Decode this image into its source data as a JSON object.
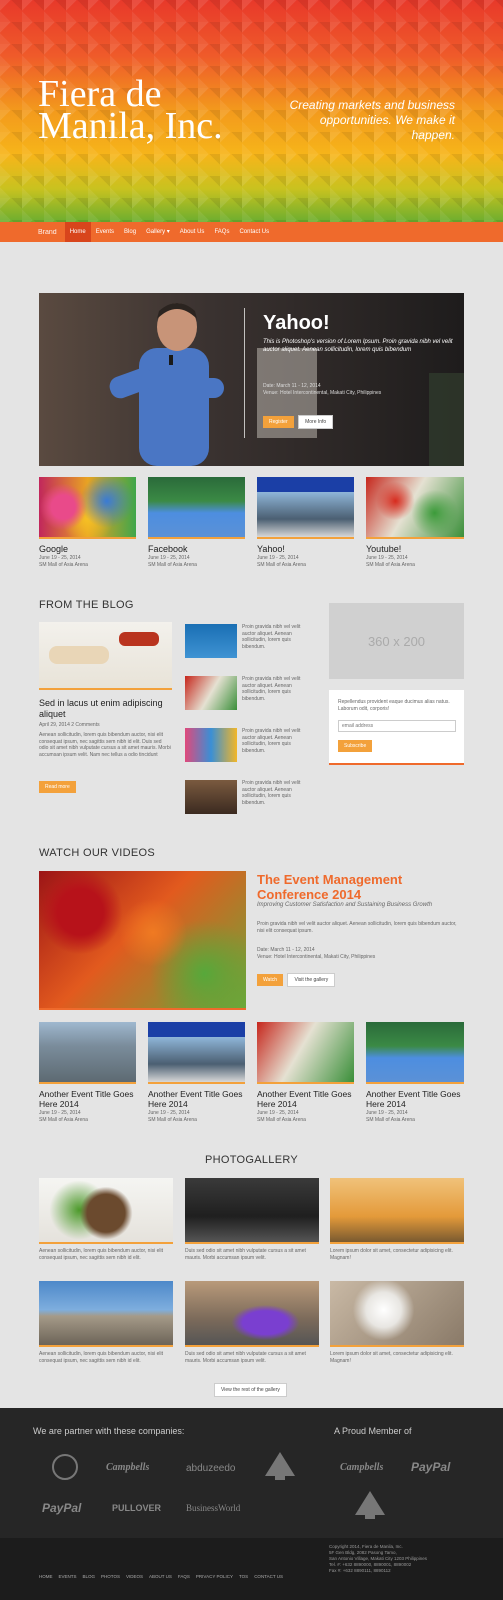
{
  "hero": {
    "title": "Fiera de Manila, Inc.",
    "tagline": "Creating markets and business opportunities. We make it happen."
  },
  "nav": {
    "brand": "Brand",
    "items": [
      "Home",
      "Events",
      "Blog",
      "Gallery ▾",
      "About Us",
      "FAQs",
      "Contact Us"
    ],
    "active_index": 0
  },
  "featured": {
    "title": "Yahoo!",
    "desc": "This is Photoshop's version of Lorem Ipsum. Proin gravida nibh vel velit auctor aliquet. Aenean sollicitudin, lorem quis bibendum",
    "date": "Date: March 11 - 12, 2014",
    "venue": "Venue: Hotel Intercontinental, Makati City, Philippines",
    "btn1": "Register",
    "btn2": "More Info"
  },
  "event_cards": [
    {
      "title": "Google",
      "date": "June 19 - 25, 2014",
      "venue": "SM Mall of Asia Arena"
    },
    {
      "title": "Facebook",
      "date": "June 19 - 25, 2014",
      "venue": "SM Mall of Asia Arena"
    },
    {
      "title": "Yahoo!",
      "date": "June 19 - 25, 2014",
      "venue": "SM Mall of Asia Arena"
    },
    {
      "title": "Youtube!",
      "date": "June 19 - 25, 2014",
      "venue": "SM Mall of Asia Arena"
    }
  ],
  "blog": {
    "heading": "FROM THE BLOG",
    "main_title": "Sed in lacus ut enim adipiscing aliquet",
    "main_meta": "April 29, 2014 2 Comments",
    "main_text": "Aenean sollicitudin, lorem quis bibendum auctor, nisi elit consequat ipsum, nec sagittis sem nibh id elit. Duis sed odio sit amet nibh vulputate cursus a sit amet mauris. Morbi accumsan ipsum velit. Nam nec tellus a odio tincidunt",
    "read_more": "Read more",
    "side_posts": [
      "Proin gravida nibh vel velit auctor aliquet. Aenean sollicitudin, lorem quis bibendum.",
      "Proin gravida nibh vel velit auctor aliquet. Aenean sollicitudin, lorem quis bibendum.",
      "Proin gravida nibh vel velit auctor aliquet. Aenean sollicitudin, lorem quis bibendum.",
      "Proin gravida nibh vel velit auctor aliquet. Aenean sollicitudin, lorem quis bibendum."
    ],
    "ad_placeholder": "360 x 200",
    "newsletter_text": "Repellendus provident eaque ducimus alias natus. Laborum odit, corporis!",
    "email_placeholder": "email address",
    "subscribe": "Subscribe"
  },
  "videos": {
    "heading": "WATCH OUR VIDEOS",
    "title": "The Event Management Conference 2014",
    "subtitle": "Improving Customer Satisfaction and Sustaining Business Growth",
    "desc": "Proin gravida nibh vel velit auctor aliquet. Aenean sollicitudin, lorem quis bibendum auctor, nisi elit consequat ipsum.",
    "date": "Date: March 11 - 12, 2014",
    "venue": "Venue: Hotel Intercontinental, Makati City, Philippines",
    "btn1": "Watch",
    "btn2": "Visit the gallery",
    "cards": [
      {
        "title": "Another Event Title Goes Here 2014",
        "date": "June 19 - 25, 2014",
        "venue": "SM Mall of Asia Arena"
      },
      {
        "title": "Another Event Title Goes Here 2014",
        "date": "June 19 - 25, 2014",
        "venue": "SM Mall of Asia Arena"
      },
      {
        "title": "Another Event Title Goes Here 2014",
        "date": "June 19 - 25, 2014",
        "venue": "SM Mall of Asia Arena"
      },
      {
        "title": "Another Event Title Goes Here 2014",
        "date": "June 19 - 25, 2014",
        "venue": "SM Mall of Asia Arena"
      }
    ]
  },
  "gallery": {
    "heading": "PHOTOGALLERY",
    "captions": [
      "Aenean sollicitudin, lorem quis bibendum auctor, nisi elit consequat ipsum, nec sagittis sem nibh id elit.",
      "Duis sed odio sit amet nibh vulputate cursus a sit amet mauris. Morbi accumsan ipsum velit.",
      "Lorem ipsum dolor sit amet, consectetur adipisicing elit. Magnam!",
      "Aenean sollicitudin, lorem quis bibendum auctor, nisi elit consequat ipsum, nec sagittis sem nibh id elit.",
      "Duis sed odio sit amet nibh vulputate cursus a sit amet mauris. Morbi accumsan ipsum velit.",
      "Lorem ipsum dolor sit amet, consectetur adipisicing elit. Magnam!"
    ],
    "view_rest": "View the rest of the gallery"
  },
  "partners": {
    "heading": "We are partner with these companies:",
    "member_heading": "A Proud Member of",
    "logos": [
      "Campbells",
      "abduzeedo",
      "PayPal",
      "PULLOVER",
      "BusinessWorld"
    ],
    "member_logos": [
      "Campbells",
      "PayPal"
    ]
  },
  "footer": {
    "links": [
      "HOME",
      "EVENTS",
      "BLOG",
      "PHOTOS",
      "VIDEOS",
      "ABOUT US",
      "FAQS",
      "PRIVACY POLICY",
      "TOS",
      "CONTACT US"
    ],
    "copyright": "Copyright 2014, Fiera de Manila, Inc.",
    "address1": "5F Gen Bldg, 2082 Pasong Tamo,",
    "address2": "San Antonio Village, Makati City 1203 Philippines",
    "phone": "Tel. #: +632 8890000, 8890001, 8890002",
    "fax": "Fax #: +632 8890111, 8890112"
  },
  "colors": {
    "accent": "#ef6a2c",
    "button": "#f3a13b",
    "dark": "#262626"
  }
}
